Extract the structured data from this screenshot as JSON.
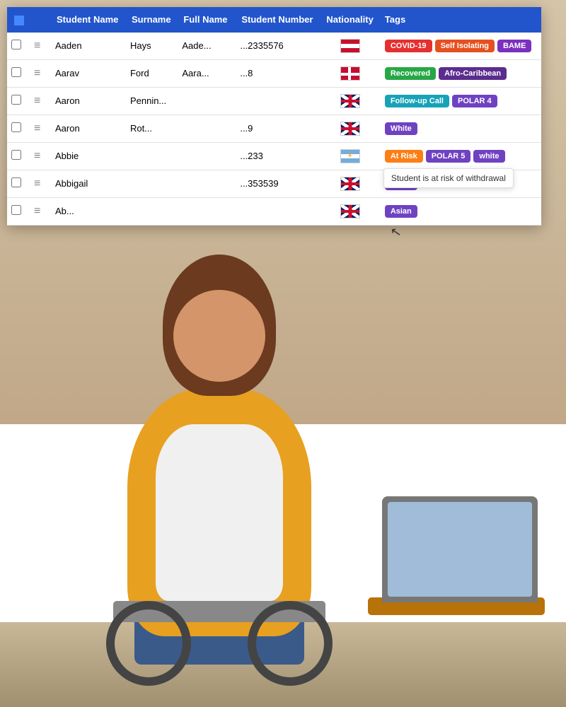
{
  "colors": {
    "tableHeaderBg": "#2255cc",
    "badgeCovid": "#e53030",
    "badgeSelfIsolating": "#e55020",
    "badgeBame": "#7b2fbe",
    "badgeRecovered": "#28a745",
    "badgeAfroCaribbbean": "#5b2d8e",
    "badgeFollowUp": "#17a2b8",
    "badgePolar": "#6f42c1",
    "badgeAtRisk": "#fd7e14",
    "badgeWhite": "#6f42c1",
    "badgeAsian": "#6f42c1"
  },
  "table": {
    "headers": [
      "",
      "",
      "Student Name",
      "Surname",
      "Full Name",
      "Student Number",
      "Nationality",
      "Tags"
    ],
    "rows": [
      {
        "id": "1",
        "checked": false,
        "studentName": "Aaden",
        "surname": "Hays",
        "fullName": "Aade...",
        "studentNumber": "...2335576",
        "nationality": "at",
        "tags": [
          {
            "label": "COVID-19",
            "class": "badge-covid"
          },
          {
            "label": "Self Isolating",
            "class": "badge-self-isolating"
          },
          {
            "label": "BAME",
            "class": "badge-bame"
          }
        ]
      },
      {
        "id": "2",
        "checked": false,
        "studentName": "Aarav",
        "surname": "Ford",
        "fullName": "Aara...",
        "studentNumber": "...8",
        "nationality": "dk",
        "tags": [
          {
            "label": "Recovered",
            "class": "badge-recovered"
          },
          {
            "label": "Afro-Caribbean",
            "class": "badge-afro-caribbean"
          }
        ]
      },
      {
        "id": "3",
        "checked": false,
        "studentName": "Aaron",
        "surname": "Pennin...",
        "fullName": "",
        "studentNumber": "",
        "nationality": "uk",
        "tags": [
          {
            "label": "Follow-up Call",
            "class": "badge-follow-up"
          },
          {
            "label": "POLAR 4",
            "class": "badge-polar4"
          }
        ]
      },
      {
        "id": "4",
        "checked": false,
        "studentName": "Aaron",
        "surname": "Rot...",
        "fullName": "",
        "studentNumber": "...9",
        "nationality": "uk",
        "tags": [
          {
            "label": "White",
            "class": "badge-white"
          }
        ]
      },
      {
        "id": "5",
        "checked": false,
        "studentName": "Abbie",
        "surname": "",
        "fullName": "",
        "studentNumber": "...233",
        "nationality": "ar",
        "tags": [
          {
            "label": "At Risk",
            "class": "badge-at-risk",
            "hasTooltip": true
          },
          {
            "label": "POLAR 5",
            "class": "badge-polar5"
          },
          {
            "label": "white",
            "class": "badge-white"
          }
        ],
        "tooltip": "Student is at risk of withdrawal"
      },
      {
        "id": "6",
        "checked": false,
        "studentName": "Abbigail",
        "surname": "",
        "fullName": "",
        "studentNumber": "...353539",
        "nationality": "uk",
        "tags": [
          {
            "label": "Asian",
            "class": "badge-asian"
          }
        ]
      },
      {
        "id": "7",
        "checked": false,
        "studentName": "Ab...",
        "surname": "",
        "fullName": "",
        "studentNumber": "",
        "nationality": "uk",
        "tags": [
          {
            "label": "Asian",
            "class": "badge-asian"
          }
        ]
      }
    ]
  }
}
